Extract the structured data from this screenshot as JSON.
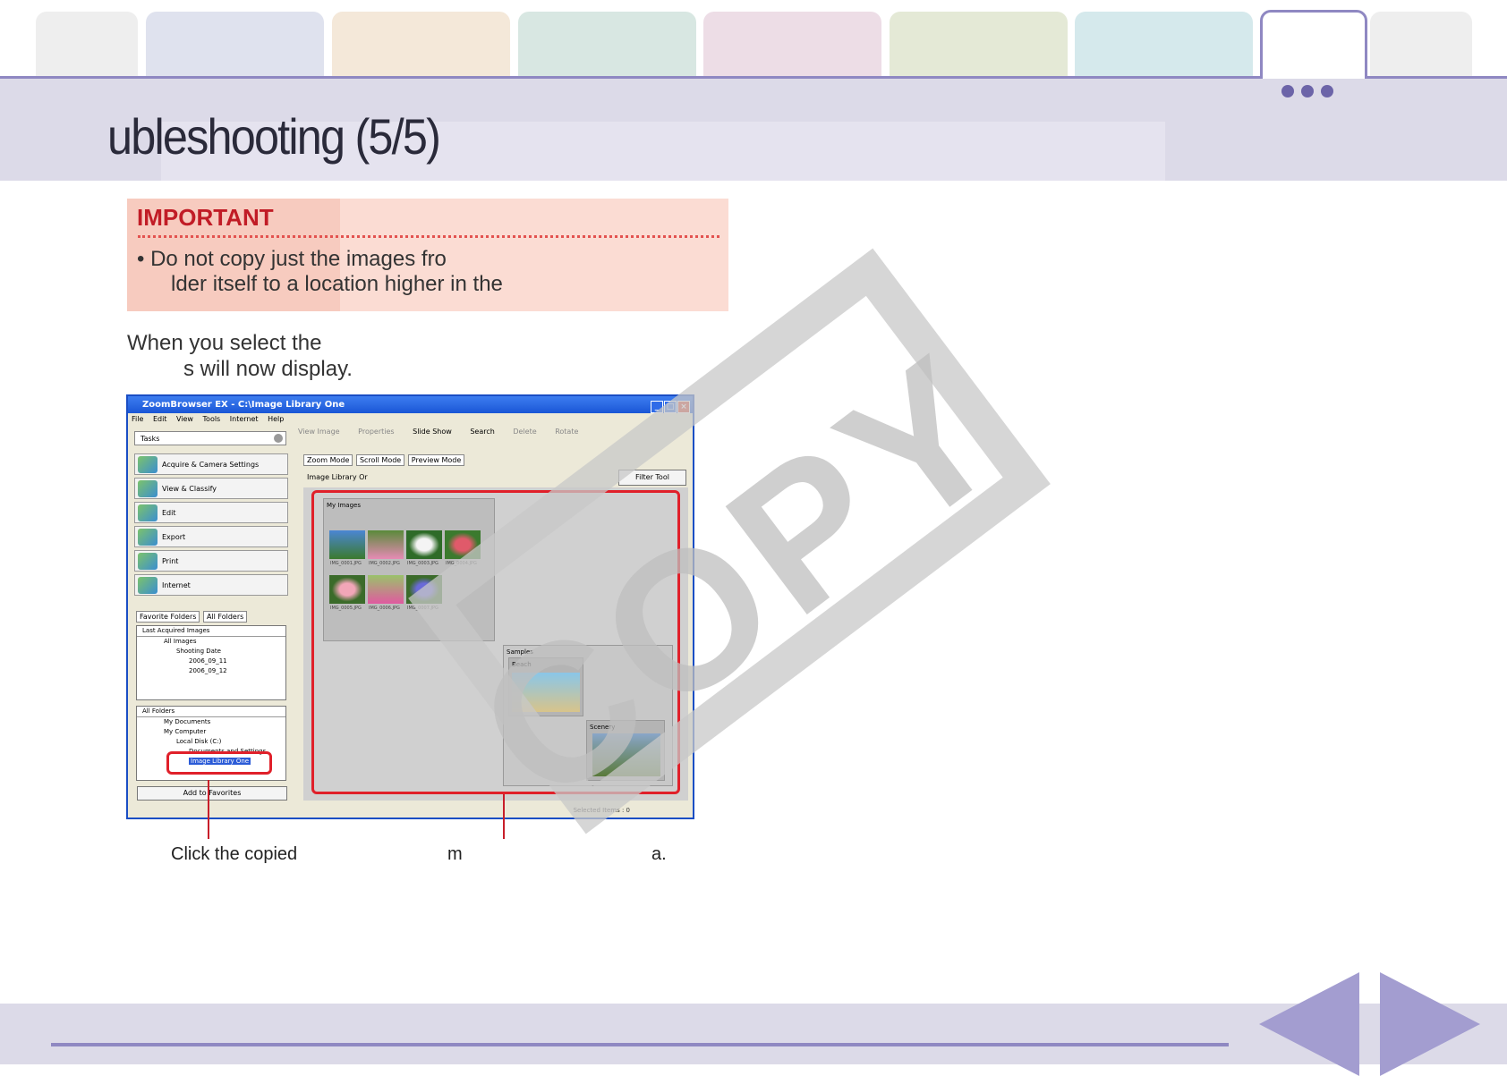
{
  "page": {
    "title": "ubleshooting (5/5)"
  },
  "important": {
    "heading": "IMPORTANT",
    "line1": "• Do not copy just the images fro",
    "line2": "lder itself to a location higher in the"
  },
  "body": {
    "line1": "When you select the",
    "line2": "s will now display."
  },
  "screenshot": {
    "window_title": "ZoomBrowser EX  -  C:\\Image Library One",
    "menu": [
      "File",
      "Edit",
      "View",
      "Tools",
      "Internet",
      "Help"
    ],
    "tasks_label": "Tasks",
    "task_buttons": [
      "Acquire & Camera Settings",
      "View & Classify",
      "Edit",
      "Export",
      "Print",
      "Internet"
    ],
    "toolbar": [
      "View Image",
      "Properties",
      "Slide Show",
      "Search",
      "Delete",
      "Rotate"
    ],
    "folder_tabs": [
      "Favorite Folders",
      "All Folders"
    ],
    "last_acquired": [
      "Last Acquired Images",
      "All Images",
      "Shooting Date",
      "2006_09_11",
      "2006_09_12"
    ],
    "all_folders": [
      "All Folders",
      "My Documents",
      "My Computer",
      "Local Disk (C:)",
      "Documents and Settings",
      "Image Library One"
    ],
    "add_favorites": "Add to Favorites",
    "mode_tabs": [
      "Zoom Mode",
      "Scroll Mode",
      "Preview Mode"
    ],
    "path_label": "Image Library Or",
    "filter_tool": "Filter Tool",
    "groups": {
      "my_images": "My Images",
      "samples": "Samples",
      "beach": "Beach",
      "scenery": "Scenery"
    },
    "thumb_labels": [
      "IMG_0001.JPG",
      "IMG_0002.JPG",
      "IMG_0003.JPG",
      "IMG_0004.JPG",
      "IMG_0005.JPG",
      "IMG_0006.JPG",
      "IMG_0007.JPG"
    ],
    "status": "Selected Items : 0"
  },
  "captions": {
    "left": "Click the copied",
    "middle": "m",
    "right": "a."
  },
  "watermark": "COPY",
  "colors": {
    "accent": "#8f88c2",
    "important_bg": "#f7cbbf",
    "important_heading": "#c11c26",
    "callout_red": "#e0202a"
  }
}
